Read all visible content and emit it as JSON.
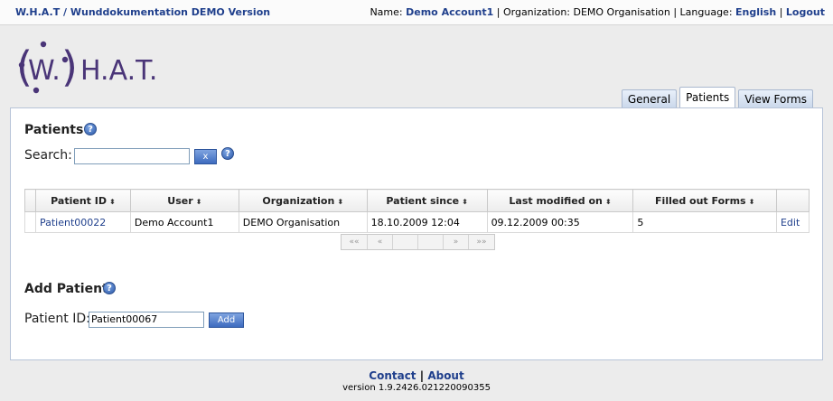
{
  "header": {
    "app_title": "W.H.A.T / Wunddokumentation DEMO Version",
    "name_label": "Name:",
    "user_name": "Demo Account1",
    "org_label": "| Organization: DEMO Organisation | Language:",
    "language": "English",
    "separator": "|",
    "logout": "Logout"
  },
  "logo": {
    "text": "H.A.T.",
    "w": "W.",
    "open_paren": "(",
    "close_paren": ")"
  },
  "tabs": [
    {
      "label": "General"
    },
    {
      "label": "Patients"
    },
    {
      "label": "View Forms"
    }
  ],
  "patients": {
    "heading": "Patients",
    "help_glyph": "?",
    "search_label": "Search:",
    "search_value": "",
    "clear_label": "x",
    "columns": [
      "Patient ID",
      "User",
      "Organization",
      "Patient since",
      "Last modified on",
      "Filled out Forms"
    ],
    "sort_glyph": "⬍",
    "rows": [
      {
        "patient_id": "Patient00022",
        "user": "Demo Account1",
        "organization": "DEMO Organisation",
        "patient_since": "18.10.2009 12:04",
        "last_modified": "09.12.2009 00:35",
        "forms": "5",
        "action": "Edit"
      }
    ],
    "pager": {
      "first": "««",
      "prev": "«",
      "next": "»",
      "last": "»»"
    }
  },
  "add_patient": {
    "heading": "Add Patient",
    "id_label": "Patient ID:",
    "id_value": "Patient00067",
    "add_label": "Add"
  },
  "footer": {
    "contact": "Contact",
    "separator": "|",
    "about": "About",
    "version": "version 1.9.2426.021220090355"
  },
  "colors": {
    "accent": "#1f3f8c",
    "button": "#3d6bbf",
    "logo": "#4a3578"
  }
}
